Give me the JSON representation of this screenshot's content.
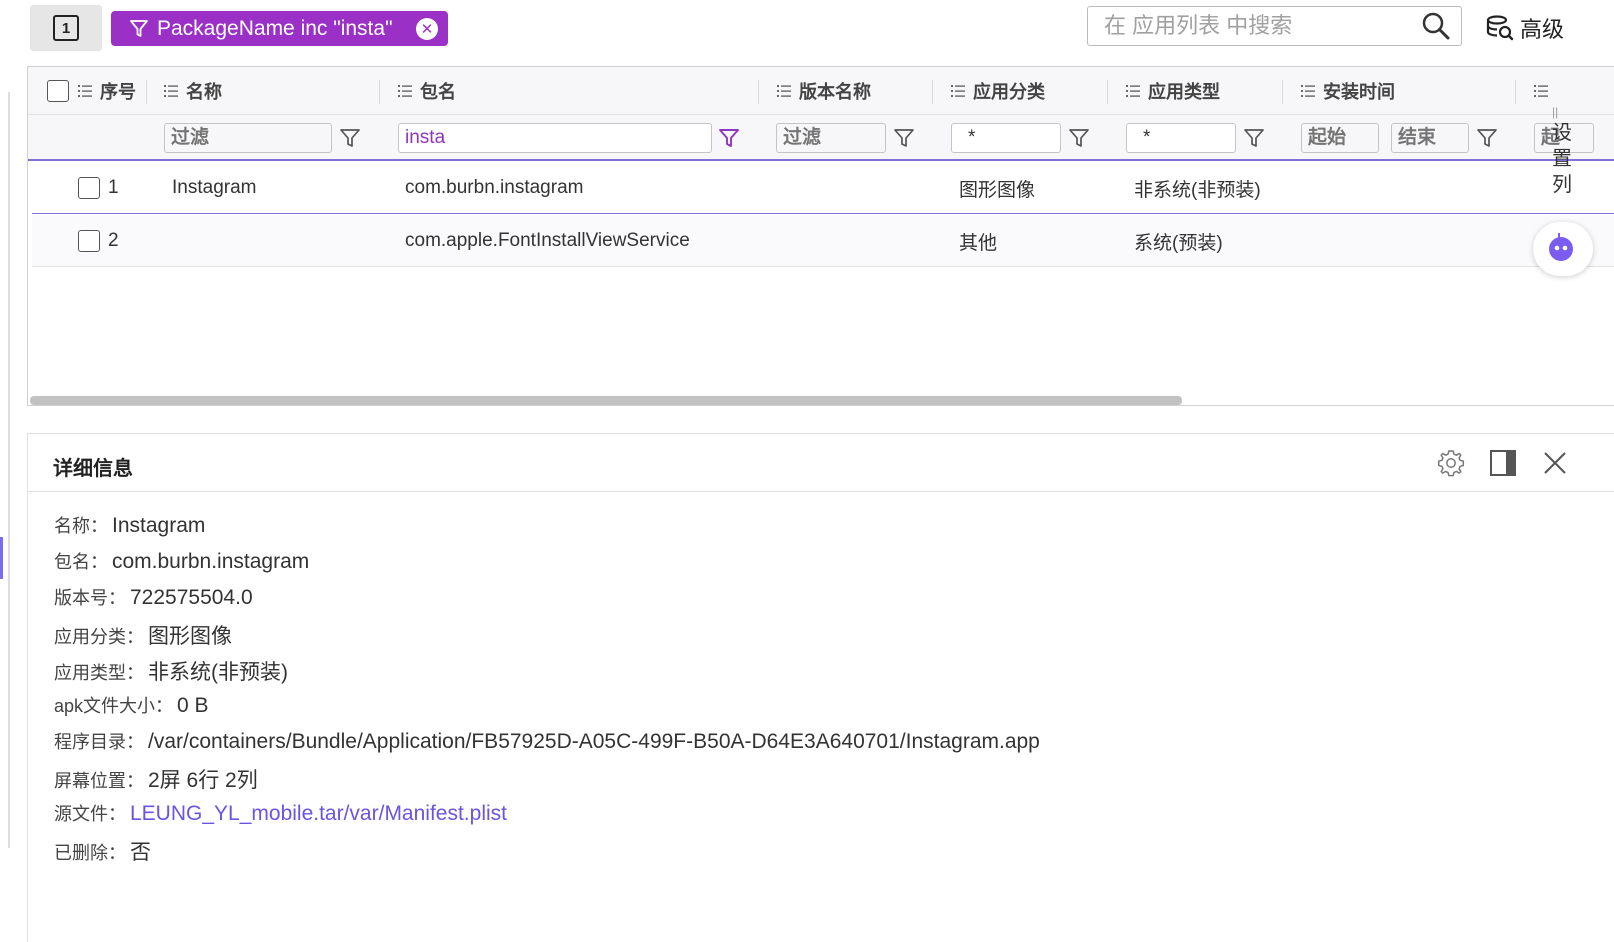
{
  "toolbar": {
    "view_toggle_label": "1",
    "filter_tag_text": "PackageName inc \"insta\"",
    "search_placeholder": "在 应用列表 中搜索",
    "advanced_label": "高级"
  },
  "grid": {
    "columns": [
      "序号",
      "名称",
      "包名",
      "版本名称",
      "应用分类",
      "应用类型",
      "安装时间"
    ],
    "filters": {
      "name_placeholder": "过滤",
      "package_value": "insta",
      "version_placeholder": "过滤",
      "category_value": "*",
      "type_value": "*",
      "start_placeholder": "起始",
      "end_placeholder": "结束",
      "overflow_placeholder": "起"
    },
    "rows": [
      {
        "index": "1",
        "name": "Instagram",
        "package": "com.burbn.instagram",
        "version": "",
        "category": "图形图像",
        "type": "非系统(非预装)",
        "install_time": ""
      },
      {
        "index": "2",
        "name": "",
        "package": "com.apple.FontInstallViewService",
        "version": "",
        "category": "其他",
        "type": "系统(预装)",
        "install_time": ""
      }
    ]
  },
  "side_tab": {
    "grip": "||",
    "chars": [
      "设",
      "置",
      "列"
    ]
  },
  "detail": {
    "title": "详细信息",
    "fields": [
      {
        "label": "名称：",
        "value": "Instagram"
      },
      {
        "label": "包名：",
        "value": "com.burbn.instagram"
      },
      {
        "label": "版本号：",
        "value": "722575504.0"
      },
      {
        "label": "应用分类：",
        "value": "图形图像"
      },
      {
        "label": "应用类型：",
        "value": "非系统(非预装)"
      },
      {
        "label": "apk文件大小：",
        "value": "0 B"
      },
      {
        "label": "程序目录：",
        "value": "/var/containers/Bundle/Application/FB57925D-A05C-499F-B50A-D64E3A640701/Instagram.app"
      },
      {
        "label": "屏幕位置：",
        "value": "2屏 6行 2列"
      },
      {
        "label": "源文件：",
        "value": "LEUNG_YL_mobile.tar/var/Manifest.plist"
      },
      {
        "label": "已删除：",
        "value": "否"
      }
    ]
  },
  "colors": {
    "accent": "#9b30c6",
    "selection": "#7e72d8",
    "link": "#6a55e0"
  }
}
